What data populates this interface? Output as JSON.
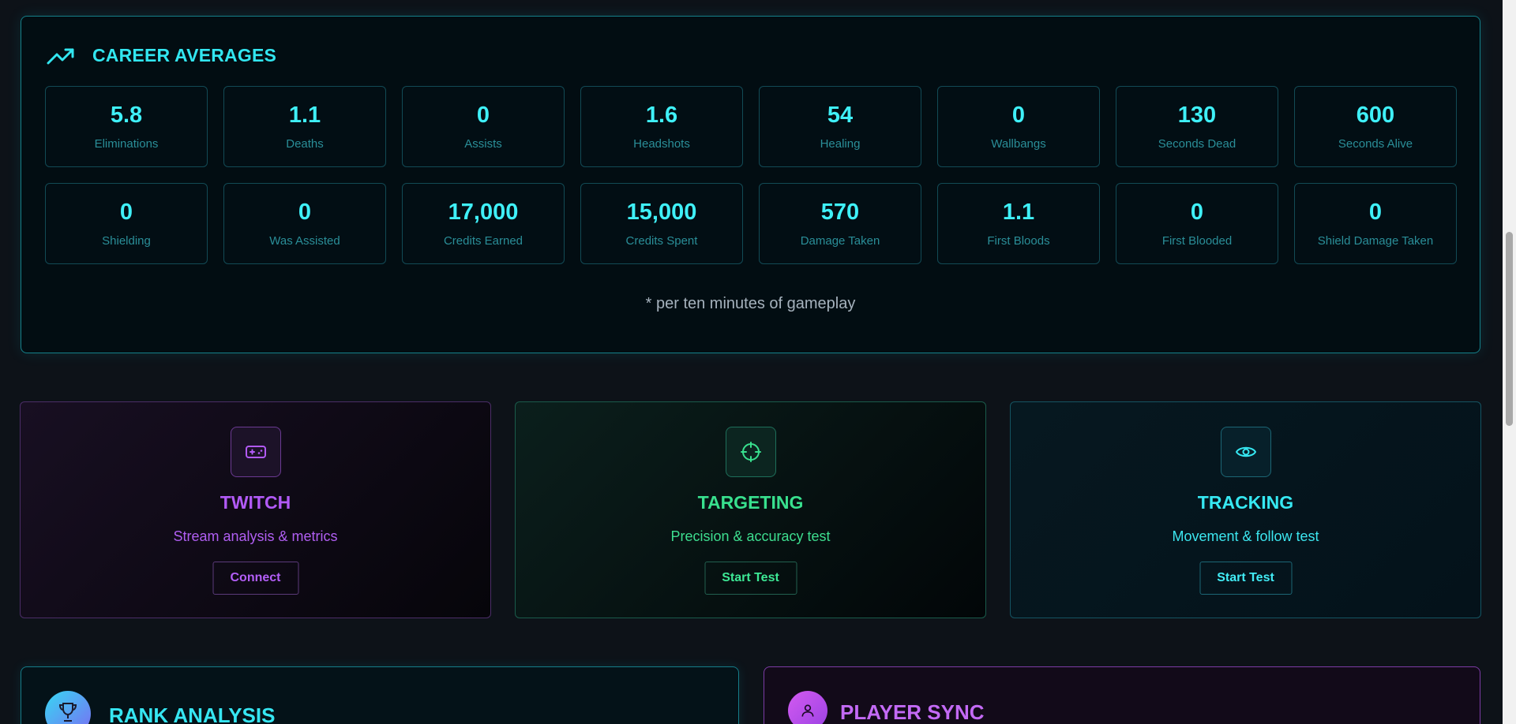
{
  "career": {
    "title": "CAREER AVERAGES",
    "stats": [
      {
        "value": "5.8",
        "label": "Eliminations"
      },
      {
        "value": "1.1",
        "label": "Deaths"
      },
      {
        "value": "0",
        "label": "Assists"
      },
      {
        "value": "1.6",
        "label": "Headshots"
      },
      {
        "value": "54",
        "label": "Healing"
      },
      {
        "value": "0",
        "label": "Wallbangs"
      },
      {
        "value": "130",
        "label": "Seconds Dead"
      },
      {
        "value": "600",
        "label": "Seconds Alive"
      },
      {
        "value": "0",
        "label": "Shielding"
      },
      {
        "value": "0",
        "label": "Was Assisted"
      },
      {
        "value": "17,000",
        "label": "Credits Earned"
      },
      {
        "value": "15,000",
        "label": "Credits Spent"
      },
      {
        "value": "570",
        "label": "Damage Taken"
      },
      {
        "value": "1.1",
        "label": "First Bloods"
      },
      {
        "value": "0",
        "label": "First Blooded"
      },
      {
        "value": "0",
        "label": "Shield Damage Taken"
      }
    ],
    "footnote": "* per ten minutes of gameplay"
  },
  "cards": {
    "twitch": {
      "title": "TWITCH",
      "desc": "Stream analysis & metrics",
      "button": "Connect",
      "icon": "gamepad-icon"
    },
    "targeting": {
      "title": "TARGETING",
      "desc": "Precision & accuracy test",
      "button": "Start Test",
      "icon": "crosshair-icon"
    },
    "tracking": {
      "title": "TRACKING",
      "desc": "Movement & follow test",
      "button": "Start Test",
      "icon": "eye-icon"
    }
  },
  "panels": {
    "rank": {
      "title": "RANK ANALYSIS",
      "icon": "trophy-icon"
    },
    "sync": {
      "title": "PLAYER SYNC",
      "icon": "user-icon"
    }
  },
  "colors": {
    "cyan": "#32e6f0",
    "purple": "#b25af7",
    "green": "#38e08e"
  }
}
